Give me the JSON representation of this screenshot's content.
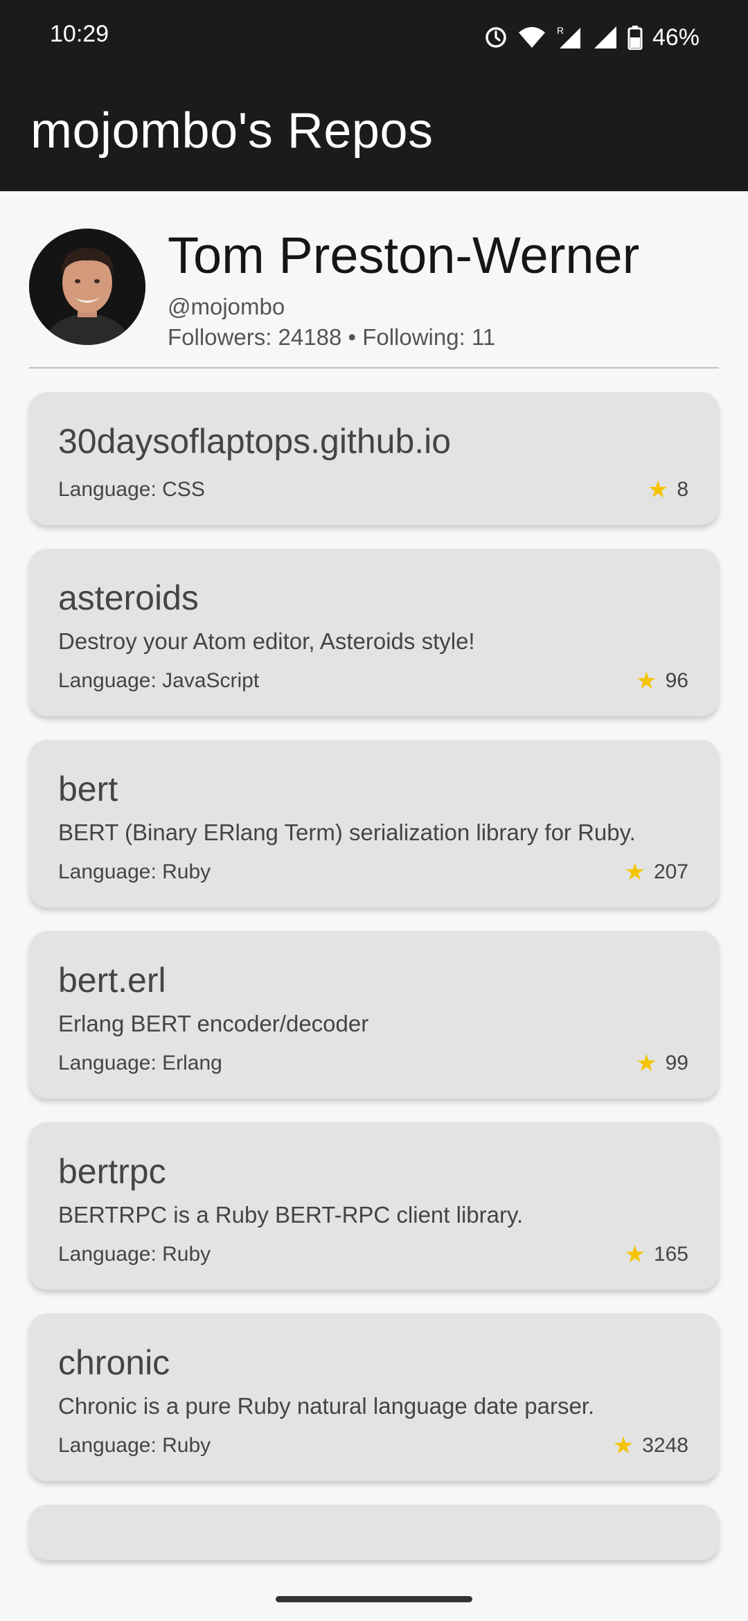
{
  "status_bar": {
    "time": "10:29",
    "battery_percent": "46%",
    "icons": [
      "alarm-icon",
      "wifi-icon",
      "signal-roaming-icon",
      "signal-icon",
      "battery-icon"
    ]
  },
  "app_bar": {
    "title": "mojombo's Repos"
  },
  "profile": {
    "name": "Tom Preston-Werner",
    "handle": "@mojombo",
    "followers_following": "Followers: 24188 • Following: 11"
  },
  "repos": [
    {
      "name": "30daysoflaptops.github.io",
      "description": "",
      "language": "Language: CSS",
      "stars": "8"
    },
    {
      "name": "asteroids",
      "description": "Destroy your Atom editor, Asteroids style!",
      "language": "Language: JavaScript",
      "stars": "96"
    },
    {
      "name": "bert",
      "description": "BERT (Binary ERlang Term) serialization library for Ruby.",
      "language": "Language: Ruby",
      "stars": "207"
    },
    {
      "name": "bert.erl",
      "description": "Erlang BERT encoder/decoder",
      "language": "Language: Erlang",
      "stars": "99"
    },
    {
      "name": "bertrpc",
      "description": "BERTRPC is a Ruby BERT-RPC client library.",
      "language": "Language: Ruby",
      "stars": "165"
    },
    {
      "name": "chronic",
      "description": "Chronic is a pure Ruby natural language date parser.",
      "language": "Language: Ruby",
      "stars": "3248"
    }
  ],
  "colors": {
    "bar": "#1b1b1b",
    "card": "#e3e3e3",
    "star": "#f5c400",
    "background": "#f7f7f7"
  }
}
